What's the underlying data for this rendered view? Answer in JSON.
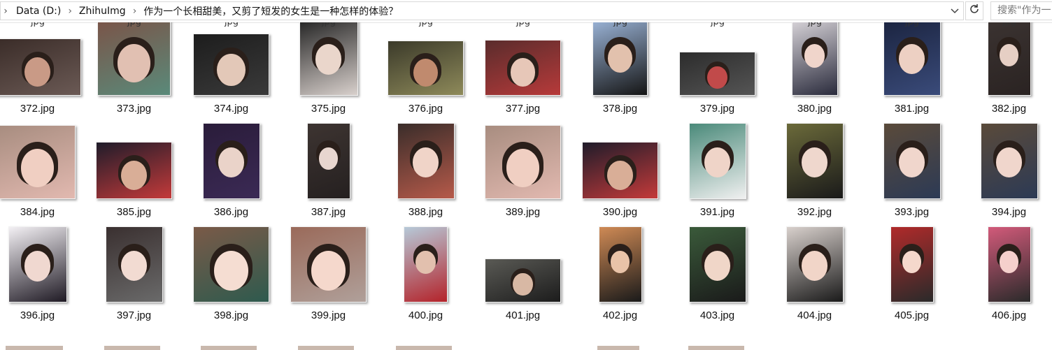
{
  "address_bar": {
    "crumbs": [
      "Data (D:)",
      "ZhihuImg",
      "作为一个长相甜美，又剪了短发的女生是一种怎样的体验？"
    ],
    "separator": "›",
    "left_chevron": "›",
    "dropdown_icon": "chevron-down-icon",
    "refresh_icon": "refresh-icon"
  },
  "search": {
    "placeholder": "搜索\"作为一"
  },
  "files": {
    "row1": [
      {
        "name": "372.jpg",
        "colors": [
          "#3a2c28",
          "#c99a86",
          "#6b5a55"
        ]
      },
      {
        "name": "373.jpg",
        "colors": [
          "#7a5448",
          "#e1c0b2",
          "#5a8a7a"
        ]
      },
      {
        "name": "374.jpg",
        "colors": [
          "#1d1d1d",
          "#e3c8b8",
          "#3a3a3a"
        ]
      },
      {
        "name": "375.jpg",
        "colors": [
          "#252525",
          "#ead6cb",
          "#d8d0cc"
        ]
      },
      {
        "name": "376.jpg",
        "colors": [
          "#3b3a2a",
          "#c08a6e",
          "#8e8a5a"
        ]
      },
      {
        "name": "377.jpg",
        "colors": [
          "#5a2c2c",
          "#e7c7b8",
          "#b73a3a"
        ]
      },
      {
        "name": "378.jpg",
        "colors": [
          "#9ab3d6",
          "#e2c1ad",
          "#151515"
        ]
      },
      {
        "name": "379.jpg",
        "colors": [
          "#2c2c2c",
          "#c14a4a",
          "#555555"
        ]
      },
      {
        "name": "380.jpg",
        "colors": [
          "#d7d3d8",
          "#f0d5cb",
          "#2a2b3c"
        ]
      },
      {
        "name": "381.jpg",
        "colors": [
          "#1b2440",
          "#edd0c3",
          "#3a4b7a"
        ]
      },
      {
        "name": "382.jpg",
        "colors": [
          "#3b3331",
          "#e6cfc4",
          "#2a2322"
        ]
      }
    ],
    "row2": [
      {
        "name": "384.jpg",
        "colors": [
          "#a88d80",
          "#f0cfc2",
          "#e2b9b0"
        ]
      },
      {
        "name": "385.jpg",
        "colors": [
          "#1f1c2a",
          "#d9ae97",
          "#c43a3a"
        ]
      },
      {
        "name": "386.jpg",
        "colors": [
          "#2a1c3a",
          "#ead3c9",
          "#3b2a55"
        ]
      },
      {
        "name": "387.jpg",
        "colors": [
          "#3d3431",
          "#e8d6cf",
          "#252020"
        ]
      },
      {
        "name": "388.jpg",
        "colors": [
          "#3a2d2a",
          "#f0d4c8",
          "#b65a4a"
        ]
      },
      {
        "name": "389.jpg",
        "colors": [
          "#a88d80",
          "#f0cfc2",
          "#e2b9b0"
        ]
      },
      {
        "name": "390.jpg",
        "colors": [
          "#1f1c2a",
          "#d9ae97",
          "#c43a3a"
        ]
      },
      {
        "name": "391.jpg",
        "colors": [
          "#4a8a7a",
          "#efd4c8",
          "#f0f0f0"
        ]
      },
      {
        "name": "392.jpg",
        "colors": [
          "#6b6a3a",
          "#efd7cd",
          "#1a1a1a"
        ]
      },
      {
        "name": "393.jpg",
        "colors": [
          "#5a4a3a",
          "#f0d6cc",
          "#2c3a55"
        ]
      },
      {
        "name": "394.jpg",
        "colors": [
          "#5a4a3a",
          "#f0d6cc",
          "#2c3a55"
        ]
      }
    ],
    "row3": [
      {
        "name": "396.jpg",
        "colors": [
          "#f3f0f4",
          "#f0d8d0",
          "#1f1a24"
        ]
      },
      {
        "name": "397.jpg",
        "colors": [
          "#3a3030",
          "#f2dbd2",
          "#6a6a6a"
        ]
      },
      {
        "name": "398.jpg",
        "colors": [
          "#7a5a48",
          "#f5ddd2",
          "#2e5a4e"
        ]
      },
      {
        "name": "399.jpg",
        "colors": [
          "#9a6a5a",
          "#f5d8cc",
          "#b0a09a"
        ]
      },
      {
        "name": "400.jpg",
        "colors": [
          "#b6c9d8",
          "#e2c0ae",
          "#b4232a"
        ]
      },
      {
        "name": "401.jpg",
        "colors": [
          "#5a5a55",
          "#d8b8a4",
          "#1c1c1c"
        ]
      },
      {
        "name": "402.jpg",
        "colors": [
          "#cf8a55",
          "#e9c3a8",
          "#1a1a1a"
        ]
      },
      {
        "name": "403.jpg",
        "colors": [
          "#3a5a3a",
          "#f0d6c8",
          "#1a1a1a"
        ]
      },
      {
        "name": "404.jpg",
        "colors": [
          "#d8d0cc",
          "#f1d5c8",
          "#1a1a1a"
        ]
      },
      {
        "name": "405.jpg",
        "colors": [
          "#b02a2a",
          "#f5d8cc",
          "#2a2a2a"
        ]
      },
      {
        "name": "406.jpg",
        "colors": [
          "#d25a7a",
          "#f5d0cc",
          "#2a2a2a"
        ]
      }
    ]
  },
  "top_partial_label": "jpg"
}
